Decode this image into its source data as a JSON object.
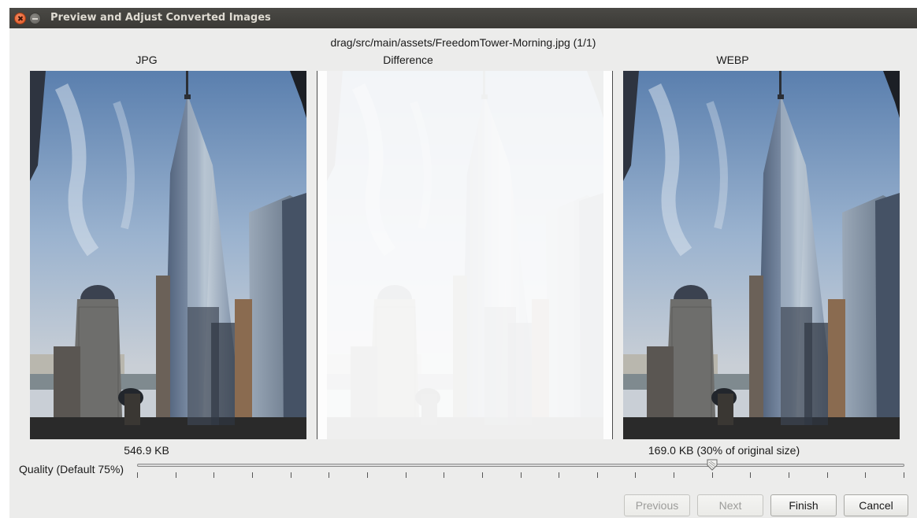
{
  "window": {
    "title": "Preview and Adjust Converted Images"
  },
  "header": {
    "file_path": "drag/src/main/assets/FreedomTower-Morning.jpg (1/1)"
  },
  "columns": {
    "left_label": "JPG",
    "middle_label": "Difference",
    "right_label": "WEBP"
  },
  "sizes": {
    "original": "546.9 KB",
    "converted": "169.0 KB (30% of original size)"
  },
  "quality": {
    "label": "Quality (Default 75%)",
    "value_percent": 75,
    "tick_count": 20
  },
  "buttons": {
    "previous": "Previous",
    "next": "Next",
    "finish": "Finish",
    "cancel": "Cancel"
  }
}
